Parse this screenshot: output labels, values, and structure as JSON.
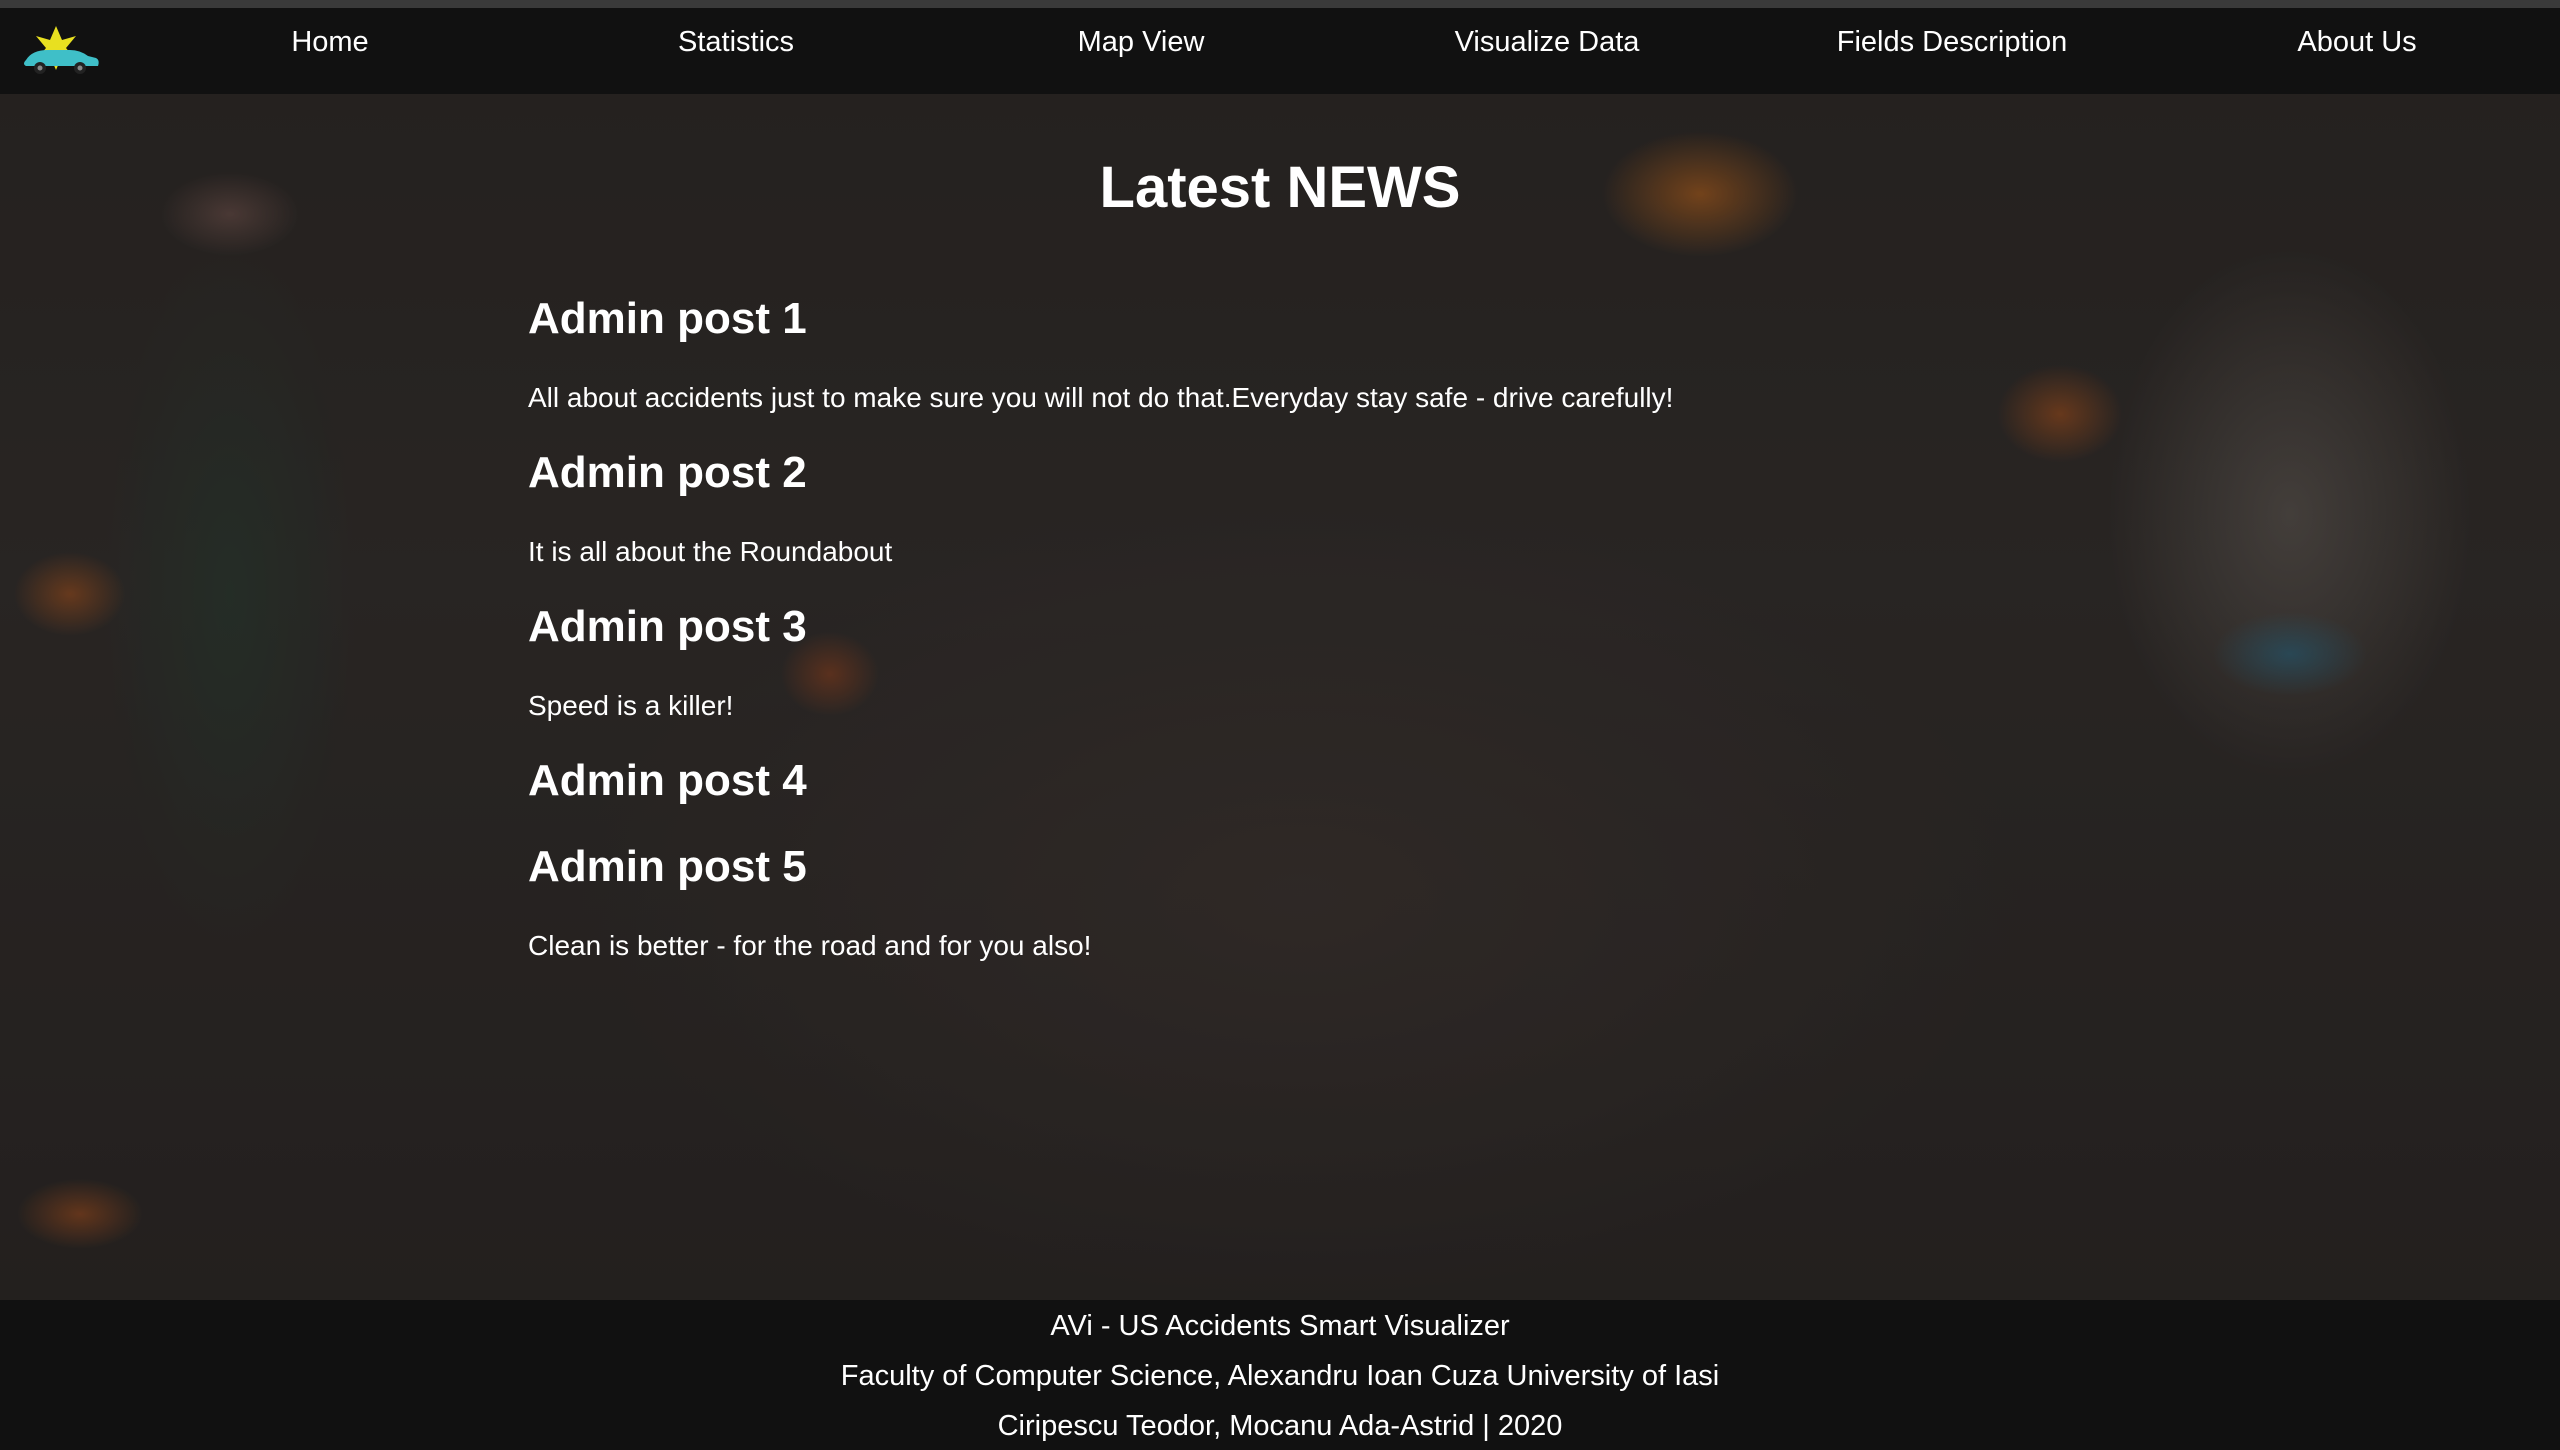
{
  "nav": {
    "logo_icon": "car-star-logo-icon",
    "items": [
      {
        "label": "Home"
      },
      {
        "label": "Statistics"
      },
      {
        "label": "Map View"
      },
      {
        "label": "Visualize Data"
      },
      {
        "label": "Fields Description"
      },
      {
        "label": "About Us"
      }
    ]
  },
  "main": {
    "title": "Latest NEWS",
    "posts": [
      {
        "title": "Admin post 1",
        "text": "All about accidents just to make sure you will not do that.Everyday stay safe - drive carefully!"
      },
      {
        "title": "Admin post 2",
        "text": "It is all about the Roundabout"
      },
      {
        "title": "Admin post 3",
        "text": "Speed is a killer!"
      },
      {
        "title": "Admin post 4",
        "text": ""
      },
      {
        "title": "Admin post 5",
        "text": "Clean is better - for the road and for you also!"
      }
    ]
  },
  "footer": {
    "line1": "AVi - US Accidents Smart Visualizer",
    "line2": "Faculty of Computer Science, Alexandru Ioan Cuza University of Iasi",
    "line3": "Ciripescu Teodor, Mocanu Ada-Astrid | 2020"
  },
  "colors": {
    "nav_bg": "#111111",
    "text": "#ffffff",
    "footer_bg": "#111111"
  }
}
